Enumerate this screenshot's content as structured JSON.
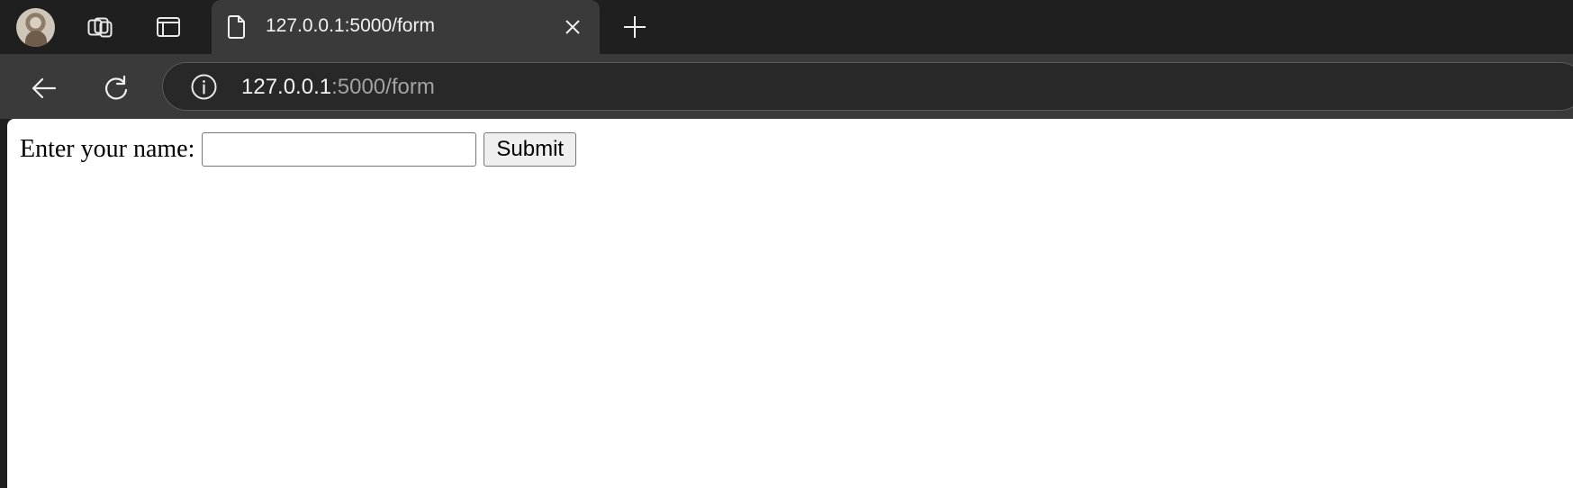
{
  "browser": {
    "tab": {
      "title": "127.0.0.1:5000/form"
    },
    "address": {
      "host": "127.0.0.1",
      "path": ":5000/form"
    },
    "icons": {
      "profile": "avatar",
      "workspaces": "workspaces-icon",
      "tab_actions": "tab-actions-icon",
      "page": "page-icon",
      "close": "close-icon",
      "new_tab": "plus-icon",
      "back": "back-arrow-icon",
      "reload": "reload-icon",
      "info": "info-icon"
    }
  },
  "page": {
    "form": {
      "label": "Enter your name:",
      "input_value": "",
      "submit_label": "Submit"
    }
  }
}
